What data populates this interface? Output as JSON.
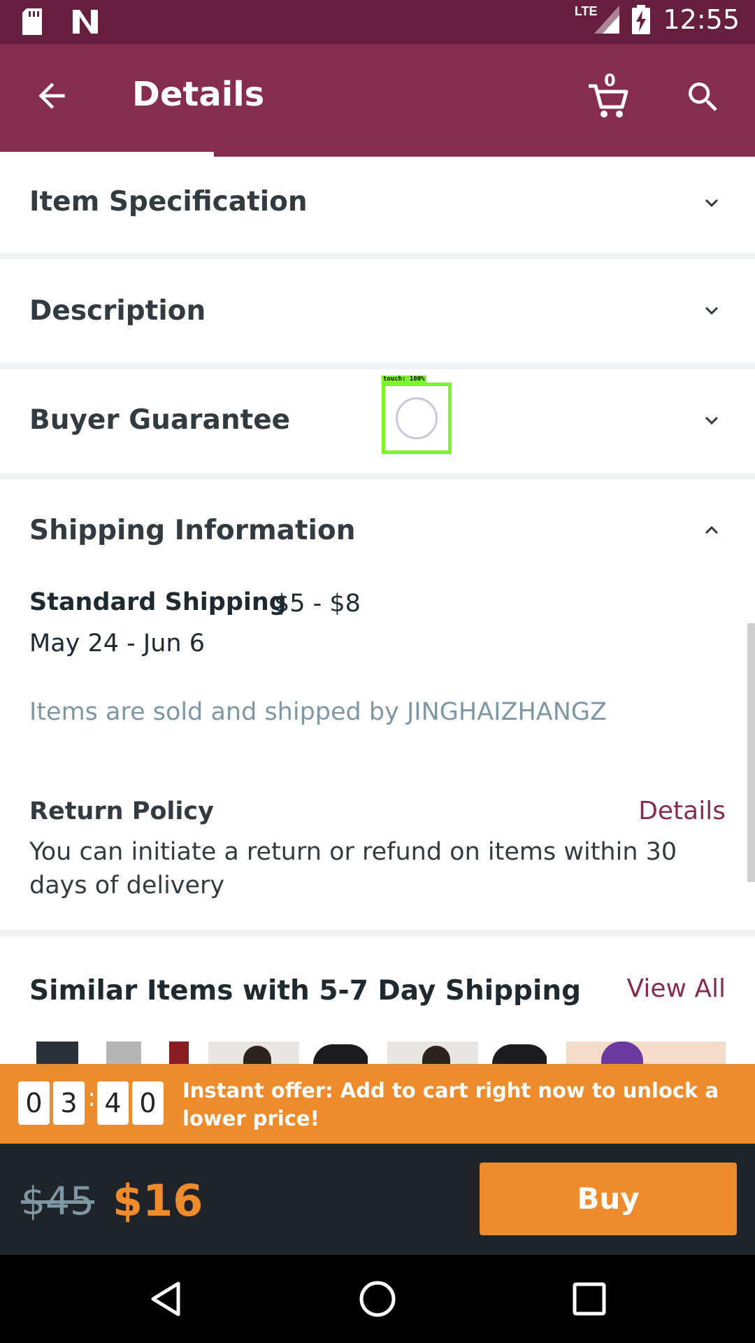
{
  "status_bar": {
    "time": "12:55",
    "network": "LTE",
    "icons": [
      "sd-card-icon",
      "n-notification-icon",
      "lte-signal-icon",
      "battery-charging-icon"
    ]
  },
  "app_bar": {
    "title": "Details",
    "cart_count": "0",
    "icons": [
      "back-arrow-icon",
      "cart-icon",
      "search-icon"
    ]
  },
  "sections": {
    "item_spec": "Item Specification",
    "description": "Description",
    "buyer_guarantee": "Buyer Guarantee",
    "shipping": "Shipping Information"
  },
  "shipping": {
    "method": "Standard Shipping",
    "price": "$5 - $8",
    "dates": "May 24 - Jun 6",
    "seller_note": "Items are sold and shipped by JINGHAIZHANGZ"
  },
  "return_policy": {
    "title": "Return Policy",
    "link": "Details",
    "text": "You can initiate a return or refund on items within 30 days of delivery"
  },
  "similar": {
    "title": "Similar Items with 5-7 Day Shipping",
    "link": "View All"
  },
  "offer": {
    "timer": [
      "0",
      "3",
      "4",
      "0"
    ],
    "separator": ":",
    "text": "Instant offer: Add to cart right now to unlock a lower price!"
  },
  "buy_bar": {
    "old_price": "$45",
    "new_price": "$16",
    "button": "Buy"
  },
  "overlay": {
    "touch_label": "touch: 100%"
  },
  "colors": {
    "brand": "#852c4f",
    "status_bar": "#66203e",
    "accent": "#ee8b2c",
    "buy_bar": "#1e2428",
    "muted": "#7f96a3"
  }
}
